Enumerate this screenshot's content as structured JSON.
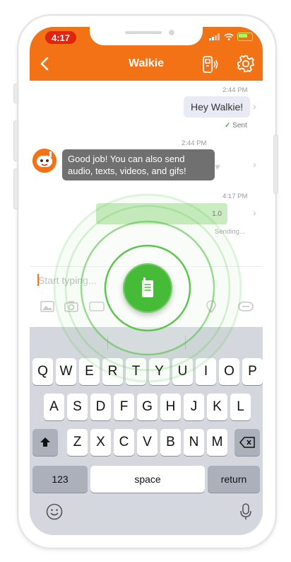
{
  "status_bar": {
    "time": "4:17"
  },
  "nav": {
    "title": "Walkie",
    "back_icon": "chevron-left-icon",
    "walkie_icon": "walkie-talkie-icon",
    "settings_icon": "gear-icon"
  },
  "messages": [
    {
      "time": "2:44 PM",
      "text": "Hey Walkie!",
      "status": "Sent",
      "direction": "outgoing"
    },
    {
      "time": "2:44 PM",
      "text": "Good job! You can also send audio, texts, videos, and gifs!",
      "direction": "incoming"
    },
    {
      "time": "4:17 PM",
      "duration": "1.0",
      "status": "Sending...",
      "direction": "outgoing"
    }
  ],
  "composer": {
    "placeholder": "Start typing..."
  },
  "keyboard": {
    "row1": [
      "Q",
      "W",
      "E",
      "R",
      "T",
      "Y",
      "U",
      "I",
      "O",
      "P"
    ],
    "row2": [
      "A",
      "S",
      "D",
      "F",
      "G",
      "H",
      "J",
      "K",
      "L"
    ],
    "row3": [
      "Z",
      "X",
      "C",
      "V",
      "B",
      "N",
      "M"
    ],
    "numbers_label": "123",
    "space_label": "space",
    "return_label": "return"
  },
  "colors": {
    "brand": "#f37215",
    "talk_button": "#45bb37",
    "recording_bubble": "#c9ecc0"
  }
}
